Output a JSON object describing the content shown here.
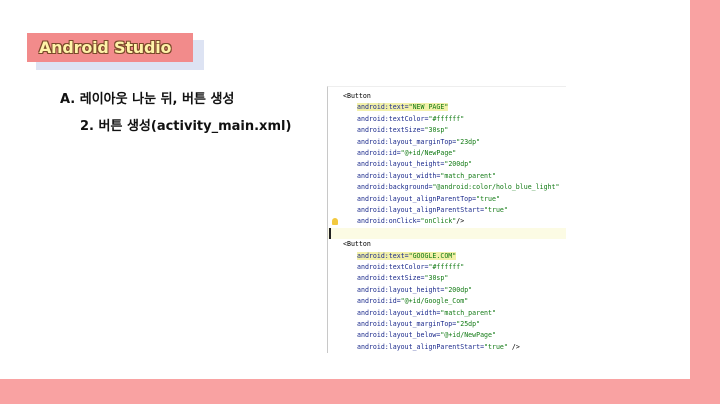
{
  "slide": {
    "title": "Android Studio",
    "heading": "A. 레이아웃 나눈 뒤, 버튼 생성",
    "subheading": "2. 버튼 생성(activity_main.xml)"
  },
  "code": {
    "lines": [
      {
        "indent": 0,
        "text": "<Button",
        "kind": "tag"
      },
      {
        "indent": 1,
        "attr": "android:text=",
        "val": "\"NEW PAGE\"",
        "hl": true
      },
      {
        "indent": 1,
        "attr": "android:textColor=",
        "val": "\"#ffffff\""
      },
      {
        "indent": 1,
        "attr": "android:textSize=",
        "val": "\"30sp\""
      },
      {
        "indent": 1,
        "attr": "android:layout_marginTop=",
        "val": "\"23dp\""
      },
      {
        "indent": 1,
        "attr": "android:id=",
        "val": "\"@+id/NewPage\""
      },
      {
        "indent": 1,
        "attr": "android:layout_height=",
        "val": "\"200dp\""
      },
      {
        "indent": 1,
        "attr": "android:layout_width=",
        "val": "\"match_parent\""
      },
      {
        "indent": 1,
        "attr": "android:background=",
        "val": "\"@android:color/holo_blue_light\""
      },
      {
        "indent": 1,
        "attr": "android:layout_alignParentTop=",
        "val": "\"true\""
      },
      {
        "indent": 1,
        "attr": "android:layout_alignParentStart=",
        "val": "\"true\""
      },
      {
        "indent": 1,
        "attr": "android:onClick=",
        "val": "\"onClick\"",
        "tail": "/>",
        "bulb": true
      },
      {
        "indent": 0,
        "text": "",
        "current": true
      },
      {
        "indent": 0,
        "text": "<Button",
        "kind": "tag"
      },
      {
        "indent": 1,
        "attr": "android:text=",
        "val": "\"GOOGLE.COM\"",
        "hl": true
      },
      {
        "indent": 1,
        "attr": "android:textColor=",
        "val": "\"#ffffff\""
      },
      {
        "indent": 1,
        "attr": "android:textSize=",
        "val": "\"30sp\""
      },
      {
        "indent": 1,
        "attr": "android:layout_height=",
        "val": "\"200dp\""
      },
      {
        "indent": 1,
        "attr": "android:id=",
        "val": "\"@+id/Google_Com\""
      },
      {
        "indent": 1,
        "attr": "android:layout_width=",
        "val": "\"match_parent\""
      },
      {
        "indent": 1,
        "attr": "android:layout_marginTop=",
        "val": "\"25dp\""
      },
      {
        "indent": 1,
        "attr": "android:layout_below=",
        "val": "\"@+id/NewPage\""
      },
      {
        "indent": 1,
        "attr": "android:layout_alignParentStart=",
        "val": "\"true\"",
        "tail": " />"
      }
    ]
  },
  "colors": {
    "accent_pink": "#f9a2a2",
    "title_bg": "#f28b8b",
    "title_text": "#fff3a8",
    "attr_color": "#1b2a8c",
    "value_color": "#127a14"
  }
}
